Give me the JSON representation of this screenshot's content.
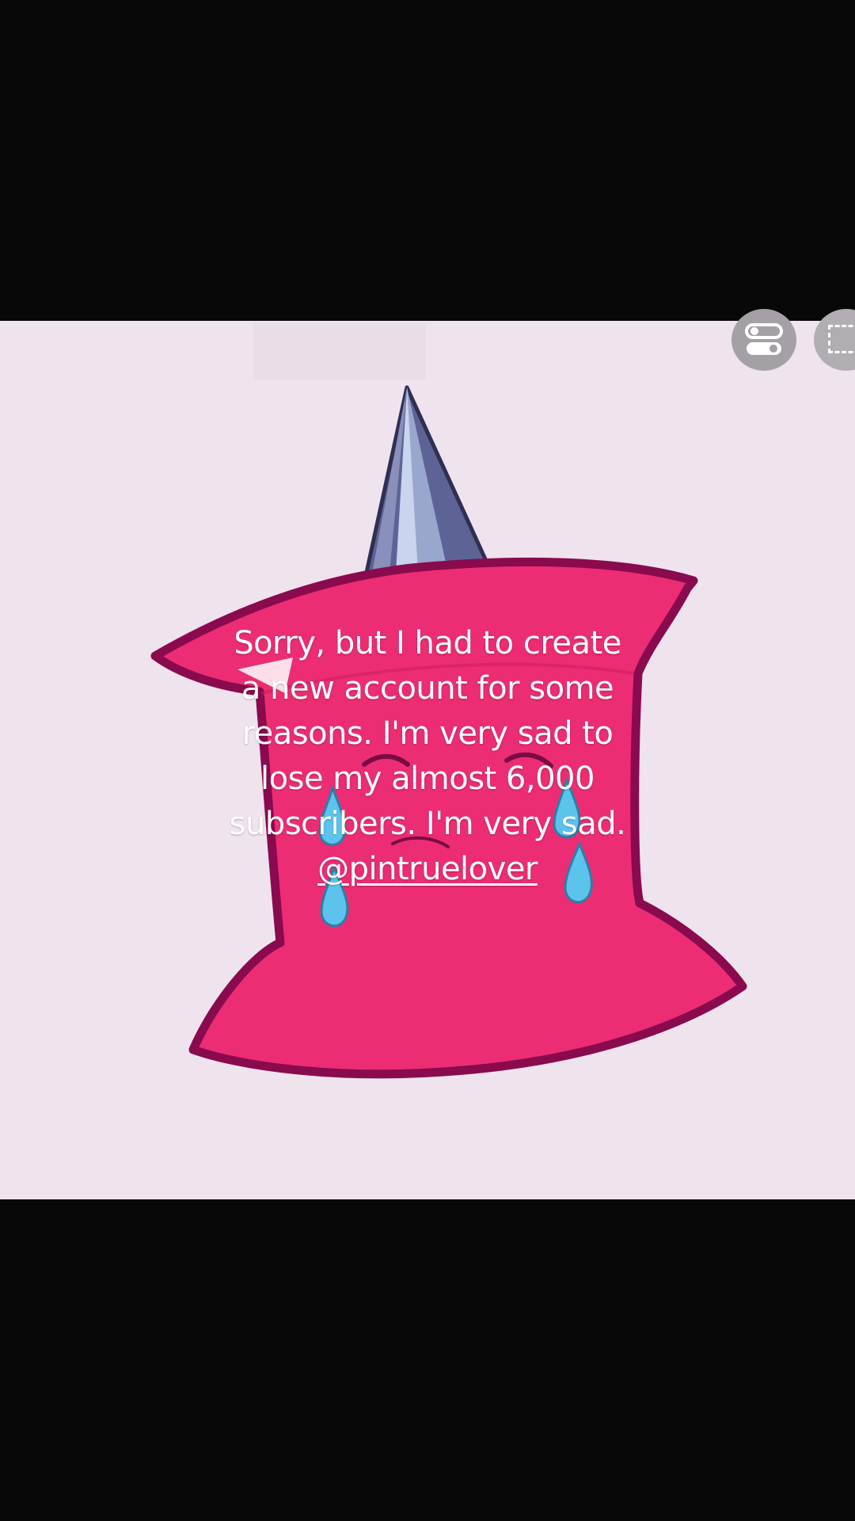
{
  "caption": {
    "lines": [
      "Sorry, but I had to create",
      "a new account for some",
      "reasons. I'm very sad to",
      "lose my almost 6,000",
      "subscribers. I'm very sad."
    ],
    "mention": "@pintruelover"
  },
  "controls": {
    "toggle_icon": "toggle-switch-icon",
    "select_icon": "dashed-select-icon"
  },
  "colors": {
    "letterbox": "#080808",
    "background": "#efe3ee",
    "character_fill": "#ec2d73",
    "character_outline": "#8a0a4e",
    "hat": "#6a6f9c",
    "tears": "#5cc3ec",
    "caption_text": "#ffffff"
  }
}
